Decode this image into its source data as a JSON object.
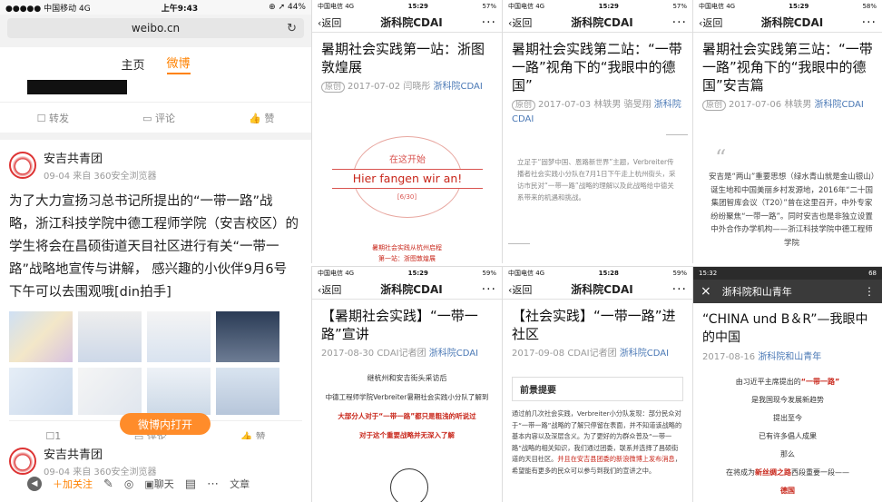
{
  "weibo": {
    "status": {
      "carrier": "●●●●● 中国移动 4G",
      "time": "上午9:43",
      "battery": "⊕ ➚ 44%"
    },
    "url": "weibo.cn",
    "tabs": [
      "主页",
      "微博"
    ],
    "repost": "转发",
    "comment": "评论",
    "like": "赞",
    "post": {
      "user": "安吉共青团",
      "meta": "09-04 来自 360安全浏览器",
      "text": "为了大力宣扬习总书记所提出的“一带一路”战略，浙江科技学院中德工程师学院（安吉校区）的学生将会在昌硕街道天目社区进行有关“一带一路”战略地宣传与讲解， 感兴趣的小伙伴9月6号下午可以去围观哦[din拍手]"
    },
    "repost_count": "1",
    "open_btn": "微博内打开",
    "post2": {
      "user": "安吉共青团",
      "meta": "09-04 来自 360安全浏览器"
    },
    "bottom": {
      "follow": "加关注",
      "chat": "聊天",
      "article": "文章"
    }
  },
  "p1": {
    "status": {
      "carrier": "中国电信 4G",
      "time": "15:29",
      "battery": "57%"
    },
    "back": "返回",
    "title": "浙科院CDAI",
    "art_title": "暑期社会实践第一站：浙图敦煌展",
    "orig": "原创",
    "date": "2017-07-02",
    "author": "闫晓彤",
    "acc": "浙科院CDAI",
    "stamp_top": "在这开始",
    "stamp_main": "Hier fangen wir an!",
    "stamp_num": "[6/30]",
    "foot1": "暑期社会实践从杭州启程",
    "foot2": "第一站：浙图敦煌展"
  },
  "p2": {
    "status": {
      "carrier": "中国电信 4G",
      "time": "15:29",
      "battery": "57%"
    },
    "back": "返回",
    "title": "浙科院CDAI",
    "art_title": "暑期社会实践第二站：“一带一路”视角下的“我眼中的德国”",
    "orig": "原创",
    "date": "2017-07-03",
    "author": "林轶男 骆旻翔",
    "acc": "浙科院CDAI",
    "body": "立足于“固梦中国、恩路新世界”主题，Verbreiter传播者社会实践小分队在7月1日下午走上杭州街头，采访市民对“一带一路”战略的理解以及此战略给中德关系带来的机遇和挑战。"
  },
  "p3": {
    "status": {
      "carrier": "中国电信 4G",
      "time": "15:29",
      "battery": "58%"
    },
    "back": "返回",
    "title": "浙科院CDAI",
    "art_title": "暑期社会实践第三站：“一带一路”视角下的“我眼中的德国”安吉篇",
    "orig": "原创",
    "date": "2017-07-06",
    "author": "林轶男",
    "acc": "浙科院CDAI",
    "body": "安吉是“两山”重要思想（绿水青山就是金山银山）诞生地和中国美丽乡村发源地，2016年“二十国集团智库会议（T20）”曾在这里召开，中外专家纷纷聚焦“一带一路”。同时安吉也是非独立设置中外合作办学机构——浙江科技学院中德工程师学院"
  },
  "p4": {
    "status": {
      "carrier": "中国电信 4G",
      "time": "15:29",
      "battery": "59%"
    },
    "back": "返回",
    "title": "浙科院CDAI",
    "art_title": "【暑期社会实践】“一带一路”宣讲",
    "date": "2017-08-30",
    "author": "CDAI记者团",
    "acc": "浙科院CDAI",
    "l1": "继杭州和安吉街头采访后",
    "l2": "中德工程师学院Verbreiter暑期社会实践小分队了解到",
    "l3": "大部分人对于“一带一路”都只是粗浅的听说过",
    "l4": "对于这个重要战略并无深入了解"
  },
  "p5": {
    "status": {
      "carrier": "中国电信 4G",
      "time": "15:28",
      "battery": "59%"
    },
    "back": "返回",
    "title": "浙科院CDAI",
    "art_title": "【社会实践】“一带一路”进社区",
    "date": "2017-09-08",
    "author": "CDAI记者团",
    "acc": "浙科院CDAI",
    "sec": "前景提要",
    "body": "通过前几次社会实践，Verbreiter小分队发现：部分民众对于“一带一路”战略的了解只停留在表面，并不知道该战略的基本内容以及深层含义。为了更好的为群众普及“一带一路”战略的相关知识，我们通过团委，联系并选择了昌硕街道的天目社区。",
    "hl": "并且在安吉县团委的新浪微博上发布消息",
    "body2": "，希望能有更多的民众可以参与到我们的宣讲之中。"
  },
  "p6": {
    "status": {
      "time": "15:32",
      "battery": "68"
    },
    "close": "×",
    "title": "浙科院和山青年",
    "art_title": "“CHINA und B＆R”—我眼中的中国",
    "date": "2017-08-16",
    "acc": "浙科院和山青年",
    "l1a": "由习近平主席提出的",
    "l1b": "“一带一路”",
    "l2": "是我国现今发展新趋势",
    "l3": "提出至今",
    "l4": "已有许多倡人成果",
    "l5": "那么",
    "l6a": "在将成为",
    "l6b": "新丝绸之路",
    "l6c": "西段重要一段——",
    "l7": "德国"
  }
}
